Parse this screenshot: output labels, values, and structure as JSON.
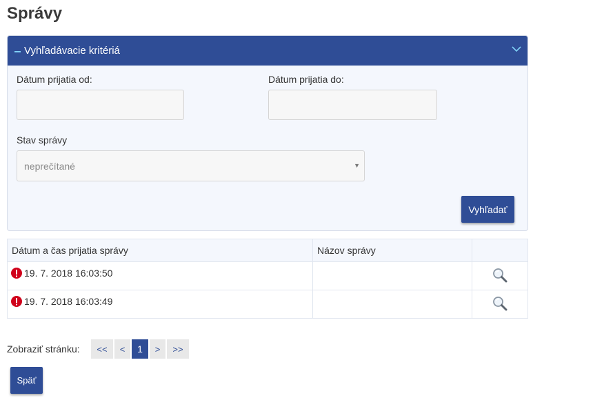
{
  "page": {
    "title": "Správy"
  },
  "search_panel": {
    "title": "Vyhľadávacie kritériá",
    "date_from_label": "Dátum prijatia od:",
    "date_from_value": "",
    "date_to_label": "Dátum prijatia do:",
    "date_to_value": "",
    "status_label": "Stav správy",
    "status_selected": "neprečítané",
    "search_button": "Vyhľadať"
  },
  "table": {
    "headers": [
      "Dátum a čas prijatia správy",
      "Názov správy",
      ""
    ],
    "rows": [
      {
        "datetime": "19. 7. 2018 16:03:50",
        "name": ""
      },
      {
        "datetime": "19. 7. 2018 16:03:49",
        "name": ""
      }
    ]
  },
  "pagination": {
    "label": "Zobraziť stránku:",
    "first": "<<",
    "prev": "<",
    "current": "1",
    "next": ">",
    "last": ">>"
  },
  "back_button": "Späť",
  "colors": {
    "primary": "#2f4d96",
    "alert": "#d0021b",
    "accent": "#7fd0f5"
  },
  "icons": {
    "collapse": "minus-icon",
    "chevron": "chevron-down-icon",
    "alert": "exclamation-circle-icon",
    "view": "magnifier-icon"
  }
}
